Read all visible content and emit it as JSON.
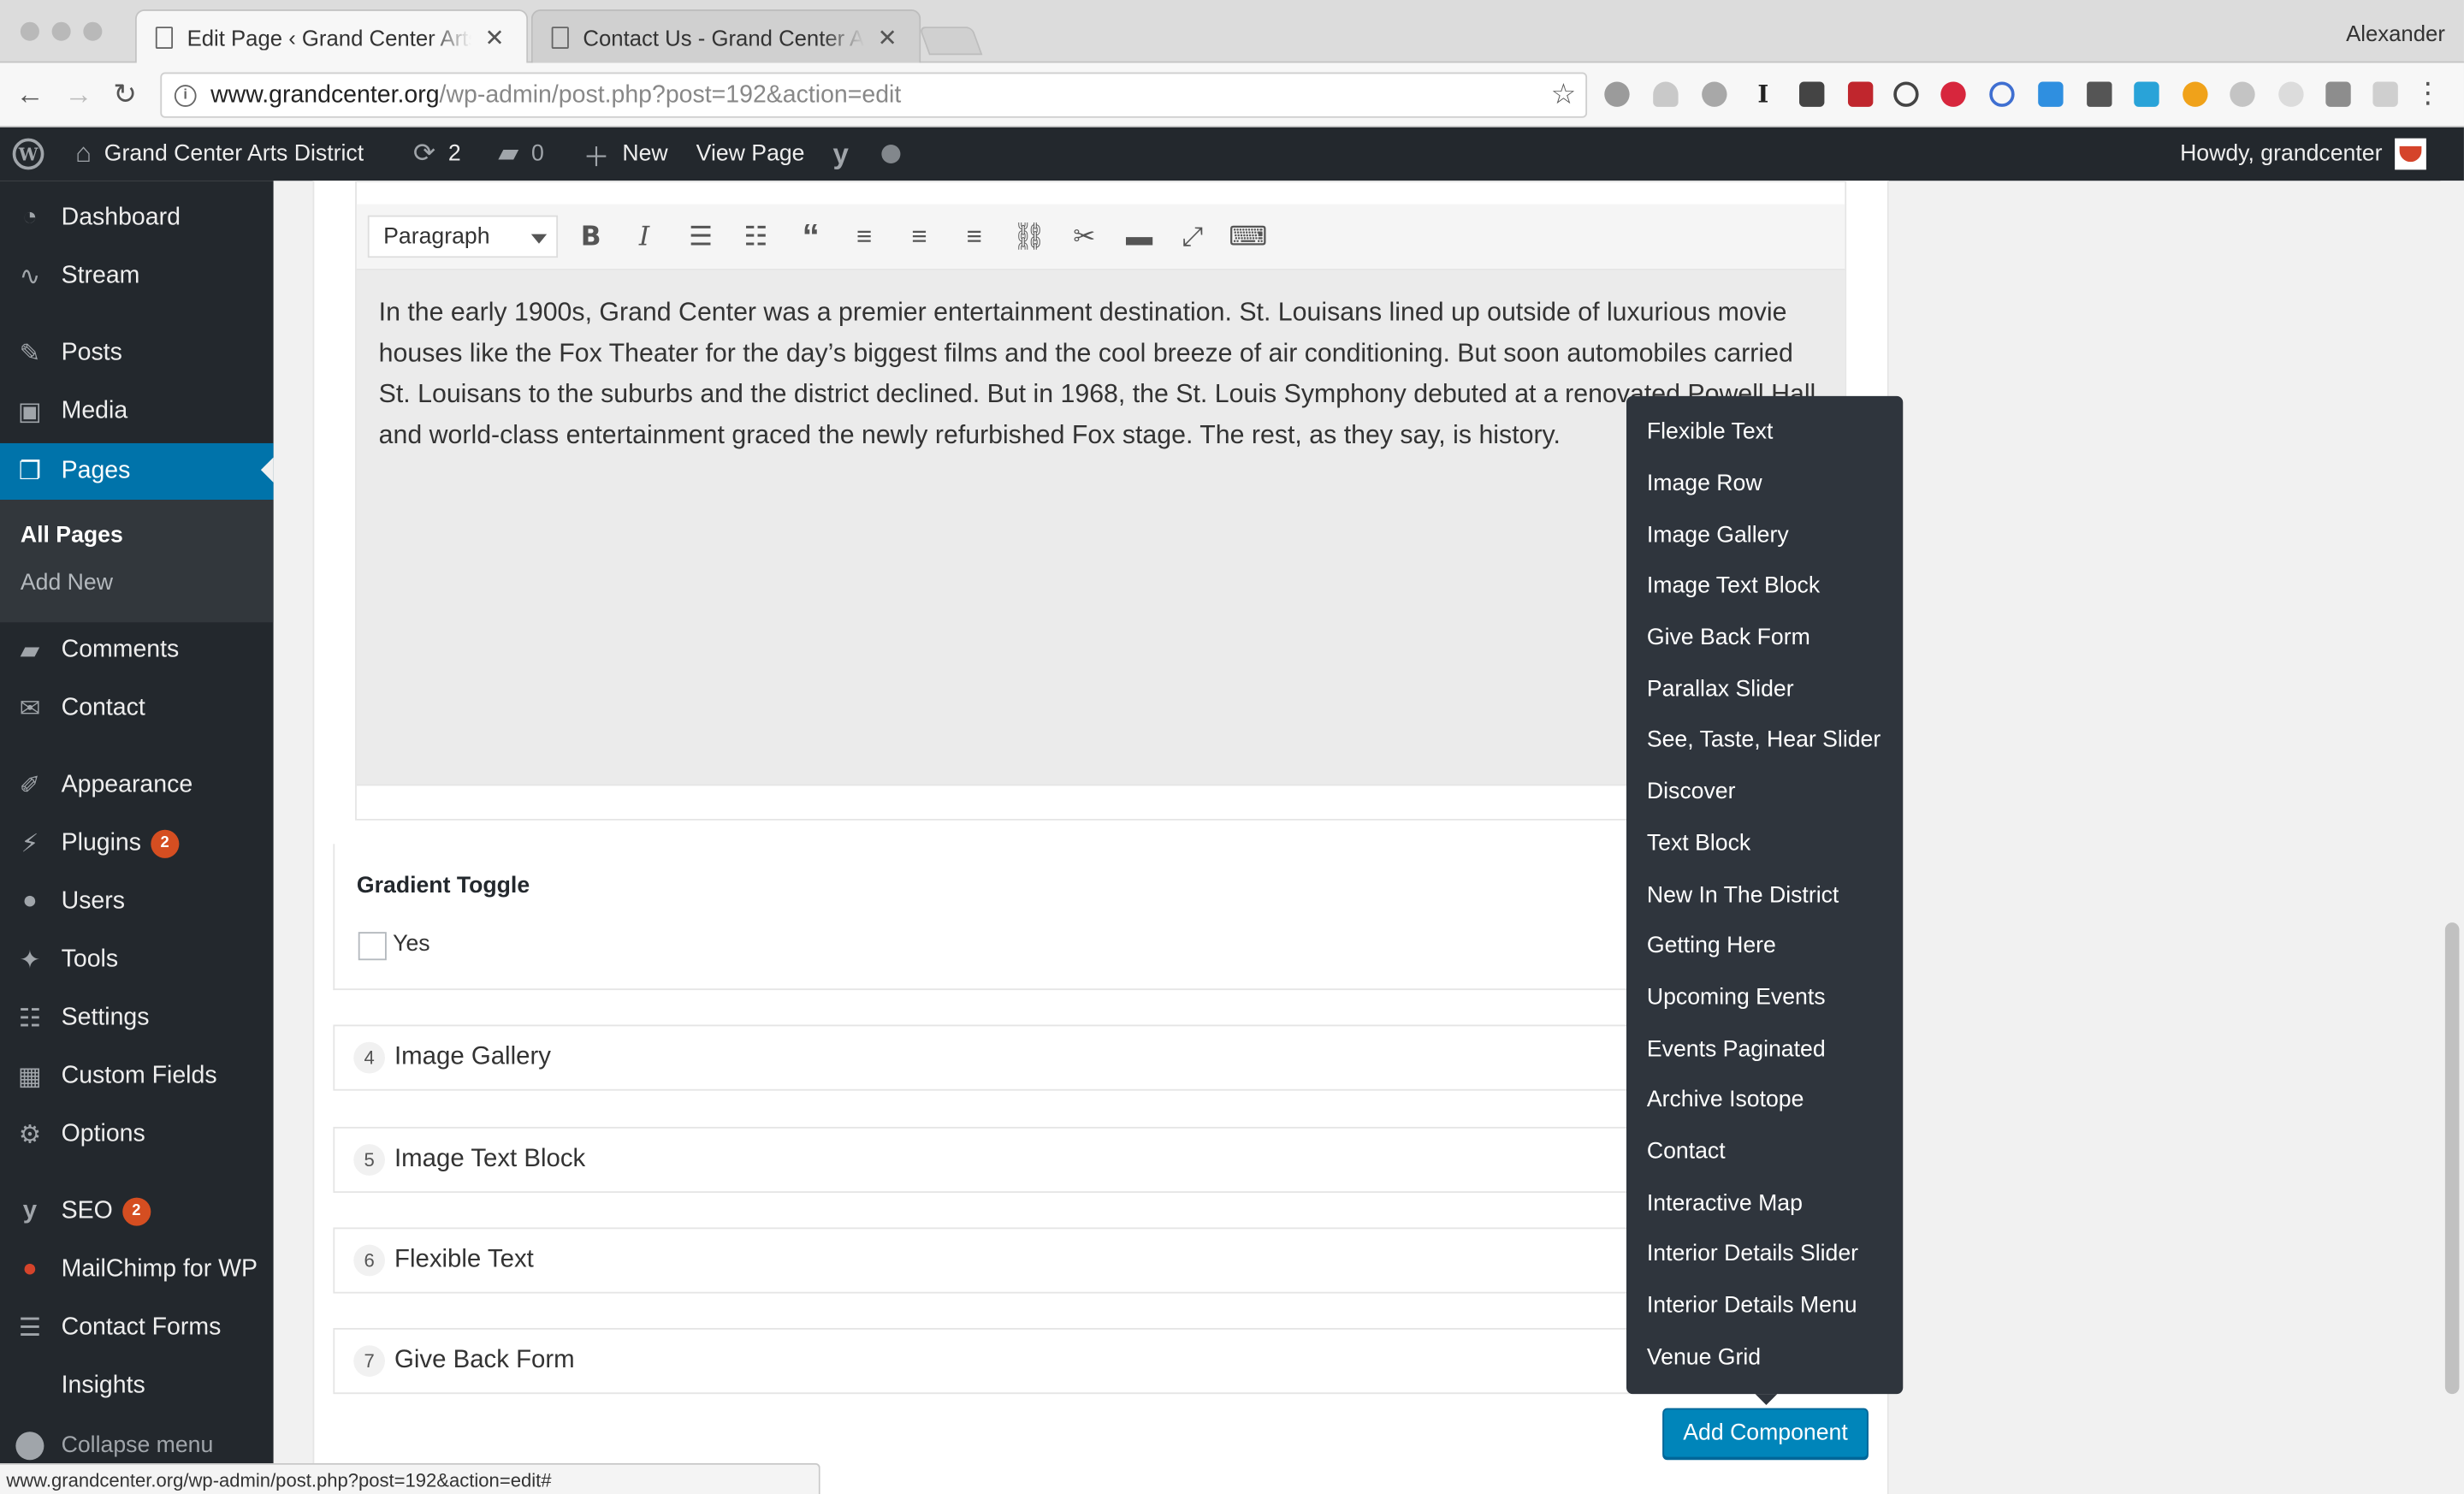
{
  "browser": {
    "tabs": [
      {
        "title": "Edit Page ‹ Grand Center Arts District"
      },
      {
        "title": "Contact Us - Grand Center Arts District"
      }
    ],
    "profile": "Alexander",
    "url_host": "www.grandcenter.org",
    "url_path": "/wp-admin/post.php?post=192&action=edit",
    "status_url": "www.grandcenter.org/wp-admin/post.php?post=192&action=edit#"
  },
  "adminbar": {
    "site_name": "Grand Center Arts District",
    "updates_count": "2",
    "comments_count": "0",
    "new_label": "New",
    "view_page_label": "View Page",
    "howdy": "Howdy, grandcenter"
  },
  "sidebar": {
    "items": [
      {
        "label": "Dashboard"
      },
      {
        "label": "Stream"
      },
      {
        "label": "Posts"
      },
      {
        "label": "Media"
      },
      {
        "label": "Pages"
      },
      {
        "label": "Comments"
      },
      {
        "label": "Contact"
      },
      {
        "label": "Appearance"
      },
      {
        "label": "Plugins",
        "badge": "2"
      },
      {
        "label": "Users"
      },
      {
        "label": "Tools"
      },
      {
        "label": "Settings"
      },
      {
        "label": "Custom Fields"
      },
      {
        "label": "Options"
      },
      {
        "label": "SEO",
        "badge": "2"
      },
      {
        "label": "MailChimp for WP"
      },
      {
        "label": "Contact Forms"
      },
      {
        "label": "Insights"
      }
    ],
    "submenu": [
      {
        "label": "All Pages"
      },
      {
        "label": "Add New"
      }
    ],
    "collapse_label": "Collapse menu"
  },
  "editor": {
    "format": "Paragraph",
    "content": "In the early 1900s, Grand Center was a premier entertainment destination. St. Louisans lined up outside of luxurious movie houses like the Fox Theater for the day’s biggest films and the cool breeze of air conditioning. But soon automobiles carried St. Louisans to the suburbs and the district declined. But in 1968, the St. Louis Symphony debuted at a renovated Powell Hall and world-class entertainment graced the newly refurbished Fox stage. The rest, as they say, is history."
  },
  "gradient_toggle": {
    "label": "Gradient Toggle",
    "option": "Yes"
  },
  "layouts": [
    {
      "num": "4",
      "label": "Image Gallery"
    },
    {
      "num": "5",
      "label": "Image Text Block"
    },
    {
      "num": "6",
      "label": "Flexible Text"
    },
    {
      "num": "7",
      "label": "Give Back Form"
    }
  ],
  "add_component_label": "Add Component",
  "component_menu": [
    "Flexible Text",
    "Image Row",
    "Image Gallery",
    "Image Text Block",
    "Give Back Form",
    "Parallax Slider",
    "See, Taste, Hear Slider",
    "Discover",
    "Text Block",
    "New In The District",
    "Getting Here",
    "Upcoming Events",
    "Events Paginated",
    "Archive Isotope",
    "Contact",
    "Interactive Map",
    "Interior Details Slider",
    "Interior Details Menu",
    "Venue Grid"
  ]
}
